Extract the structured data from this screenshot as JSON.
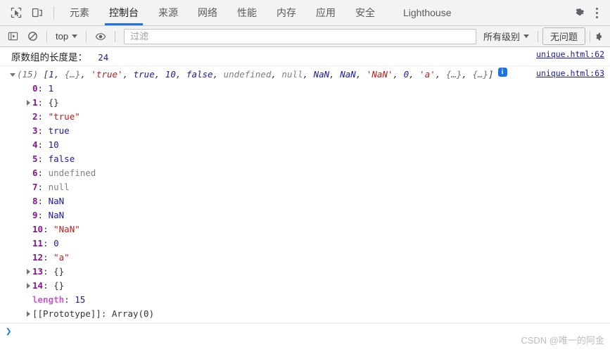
{
  "window": {
    "title": "DevTools Console"
  },
  "toolbar": {
    "inspect_icon": "inspect-cursor-icon",
    "device_icon": "device-toolbar-icon",
    "tabs": [
      {
        "label": "元素",
        "active": false
      },
      {
        "label": "控制台",
        "active": true
      },
      {
        "label": "来源",
        "active": false
      },
      {
        "label": "网络",
        "active": false
      },
      {
        "label": "性能",
        "active": false
      },
      {
        "label": "内存",
        "active": false
      },
      {
        "label": "应用",
        "active": false
      },
      {
        "label": "安全",
        "active": false
      },
      {
        "label": "Lighthouse",
        "active": false
      }
    ],
    "settings_icon": "gear-icon",
    "more_icon": "kebab-menu-icon"
  },
  "filterbar": {
    "sidebar_toggle_icon": "console-sidebar-icon",
    "clear_icon": "clear-console-icon",
    "context_selector": "top",
    "eye_icon": "live-expression-eye-icon",
    "filter_placeholder": "过滤",
    "filter_value": "",
    "level_selector": "所有级别",
    "issues_button": "无问题",
    "settings_edge_icon": "gear-icon"
  },
  "console": {
    "messages": [
      {
        "type": "text",
        "text": "原数组的长度是：",
        "value": "24",
        "source": "unique.html:62"
      },
      {
        "type": "object",
        "source": "unique.html:63",
        "preview": {
          "count": "(15)",
          "open": "[",
          "items": [
            {
              "text": "1",
              "kind": "num"
            },
            {
              "text": "{…}",
              "kind": "obj"
            },
            {
              "text": "'true'",
              "kind": "str"
            },
            {
              "text": "true",
              "kind": "bool"
            },
            {
              "text": "10",
              "kind": "num"
            },
            {
              "text": "false",
              "kind": "bool"
            },
            {
              "text": "undefined",
              "kind": "undef"
            },
            {
              "text": "null",
              "kind": "undef"
            },
            {
              "text": "NaN",
              "kind": "num"
            },
            {
              "text": "NaN",
              "kind": "num"
            },
            {
              "text": "'NaN'",
              "kind": "str"
            },
            {
              "text": "0",
              "kind": "num"
            },
            {
              "text": "'a'",
              "kind": "str"
            },
            {
              "text": "{…}",
              "kind": "obj"
            },
            {
              "text": "{…}",
              "kind": "obj"
            }
          ],
          "close": "]",
          "info_icon": "info-icon",
          "info_glyph": "i"
        },
        "properties": [
          {
            "key": "0",
            "value": "1",
            "kind": "numr",
            "expandable": false
          },
          {
            "key": "1",
            "value": "{}",
            "kind": "objr",
            "expandable": true
          },
          {
            "key": "2",
            "value": "\"true\"",
            "kind": "strr",
            "expandable": false
          },
          {
            "key": "3",
            "value": "true",
            "kind": "boolr",
            "expandable": false
          },
          {
            "key": "4",
            "value": "10",
            "kind": "numr",
            "expandable": false
          },
          {
            "key": "5",
            "value": "false",
            "kind": "boolr",
            "expandable": false
          },
          {
            "key": "6",
            "value": "undefined",
            "kind": "undefr",
            "expandable": false
          },
          {
            "key": "7",
            "value": "null",
            "kind": "undefr",
            "expandable": false
          },
          {
            "key": "8",
            "value": "NaN",
            "kind": "numr",
            "expandable": false
          },
          {
            "key": "9",
            "value": "NaN",
            "kind": "numr",
            "expandable": false
          },
          {
            "key": "10",
            "value": "\"NaN\"",
            "kind": "strr",
            "expandable": false
          },
          {
            "key": "11",
            "value": "0",
            "kind": "numr",
            "expandable": false
          },
          {
            "key": "12",
            "value": "\"a\"",
            "kind": "strr",
            "expandable": false
          },
          {
            "key": "13",
            "value": "{}",
            "kind": "objr",
            "expandable": true
          },
          {
            "key": "14",
            "value": "{}",
            "kind": "objr",
            "expandable": true
          }
        ],
        "length_key": "length",
        "length_value": "15",
        "proto_key": "[[Prototype]]",
        "proto_value": "Array(0)"
      }
    ],
    "prompt_caret": "❯",
    "prompt_value": "",
    "prompt_placeholder": ""
  },
  "watermark": "CSDN @唯一的阿金",
  "colors": {
    "accent": "#1a73e8",
    "toolbar_bg": "#f3f3f3",
    "border": "#cdcdcd",
    "string": "#c41a16",
    "number": "#1a1aa6",
    "key": "#881391",
    "muted": "#808080"
  }
}
